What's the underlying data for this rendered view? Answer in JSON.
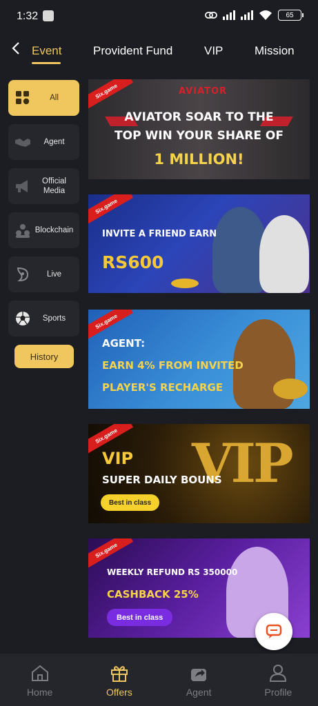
{
  "status_bar": {
    "time": "1:32",
    "battery": "65"
  },
  "nav": {
    "tabs": [
      {
        "label": "Event",
        "active": true
      },
      {
        "label": "Provident Fund",
        "active": false
      },
      {
        "label": "VIP",
        "active": false
      },
      {
        "label": "Mission",
        "active": false
      }
    ]
  },
  "sidebar": {
    "categories": [
      {
        "label": "All",
        "icon": "grid-icon",
        "active": true
      },
      {
        "label": "Agent",
        "icon": "handshake-icon",
        "active": false
      },
      {
        "label": "Official Media",
        "icon": "megaphone-icon",
        "active": false
      },
      {
        "label": "Blockchain",
        "icon": "blockchain-icon",
        "active": false
      },
      {
        "label": "Live",
        "icon": "live-icon",
        "active": false
      },
      {
        "label": "Sports",
        "icon": "soccer-ball-icon",
        "active": false
      }
    ],
    "history_label": "History"
  },
  "banners": {
    "brand_tag": "Six.game",
    "aviator": {
      "logo": "AVIATOR",
      "line1": "AVIATOR SOAR TO THE",
      "line2": "TOP WIN YOUR SHARE OF",
      "line3": "1 MILLION!"
    },
    "invite": {
      "line1": "INVITE A FRIEND EARN",
      "line2": "RS600"
    },
    "agent": {
      "line1": "AGENT:",
      "line2": "EARN 4% FROM INVITED",
      "line3": "PLAYER'S RECHARGE"
    },
    "vip": {
      "line1": "VIP",
      "line2": "SUPER DAILY BOUNS",
      "pill": "Best in class",
      "big": "VIP"
    },
    "refund": {
      "line1": "WEEKLY REFUND RS 350000",
      "line2": "CASHBACK 25%",
      "pill": "Best in class"
    }
  },
  "bottom_nav": {
    "items": [
      {
        "label": "Home",
        "icon": "home-icon",
        "active": false
      },
      {
        "label": "Offers",
        "icon": "gift-icon",
        "active": true
      },
      {
        "label": "Agent",
        "icon": "share-icon",
        "active": false
      },
      {
        "label": "Profile",
        "icon": "profile-icon",
        "active": false
      }
    ]
  },
  "colors": {
    "accent": "#f0c75e",
    "background": "#1c1d22",
    "panel": "#26272d"
  }
}
